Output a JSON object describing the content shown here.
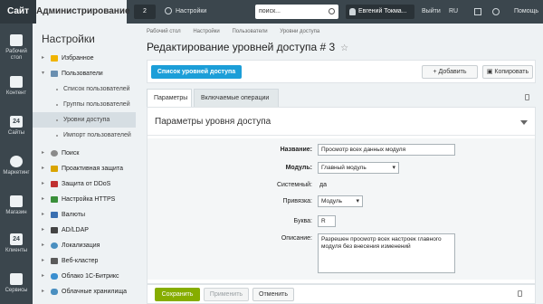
{
  "topbar": {
    "site_label": "Сайт",
    "admin_label": "Администрирование",
    "notifications_count": "2",
    "settings_label": "Настройки",
    "search_value": "поиск...",
    "user_name": "Евгений Токма...",
    "exit_label": "Выйти",
    "lang_label": "RU",
    "help_label": "Помощь"
  },
  "iconbar": [
    {
      "label": "Рабочий стол",
      "icon": "desktop-icon"
    },
    {
      "label": "Контент",
      "icon": "content-icon"
    },
    {
      "label": "Сайты",
      "icon": "sites-icon"
    },
    {
      "label": "Маркетинг",
      "icon": "marketing-icon"
    },
    {
      "label": "Магазин",
      "icon": "shop-icon"
    },
    {
      "label": "Клиенты",
      "icon": "clients-icon"
    },
    {
      "label": "Сервисы",
      "icon": "services-icon"
    }
  ],
  "iconbar_glyphs": {
    "sites": "24",
    "clients": "24"
  },
  "menu": {
    "title": "Настройки",
    "items": [
      {
        "label": "Избранное",
        "color": "#f0b400"
      },
      {
        "label": "Пользователи",
        "color": "#6a8fb0"
      },
      {
        "label": "Список пользователей"
      },
      {
        "label": "Группы пользователей"
      },
      {
        "label": "Уровни доступа"
      },
      {
        "label": "Импорт пользователей"
      },
      {
        "label": "Поиск",
        "color": "#8a8a8a"
      },
      {
        "label": "Проактивная защита",
        "color": "#d9a400"
      },
      {
        "label": "Защита от DDoS",
        "color": "#c03030"
      },
      {
        "label": "Настройка HTTPS",
        "color": "#3a8f3a"
      },
      {
        "label": "Валюты",
        "color": "#3a6fb0"
      },
      {
        "label": "AD/LDAP",
        "color": "#444444"
      },
      {
        "label": "Локализация",
        "color": "#4a8fc0"
      },
      {
        "label": "Веб-кластер",
        "color": "#5a5a5a"
      },
      {
        "label": "Облако 1С-Битрикс",
        "color": "#3a8fd0"
      },
      {
        "label": "Облачные хранилища",
        "color": "#4a8fc0"
      }
    ]
  },
  "breadcrumbs": [
    "Рабочий стол",
    "Настройки",
    "Пользователи",
    "Уровни доступа"
  ],
  "page_title": "Редактирование уровней доступа # 3",
  "toolbar": {
    "list_button": "Список уровней доступа",
    "add_button": "Добавить",
    "copy_button": "Копировать"
  },
  "tabs": [
    "Параметры",
    "Включаемые операции"
  ],
  "panel": {
    "title": "Параметры уровня доступа",
    "fields": {
      "name_label": "Название:",
      "name_value": "Просмотр всех данных модуля",
      "module_label": "Модуль:",
      "module_value": "Главный модуль",
      "system_label": "Системный:",
      "system_value": "да",
      "binding_label": "Привязка:",
      "binding_value": "Модуль",
      "letter_label": "Буква:",
      "letter_value": "R",
      "description_label": "Описание:",
      "description_value": "Разрешен просмотр всех настроек главного модуля без внесения изменений"
    }
  },
  "footer": {
    "save": "Сохранить",
    "apply": "Применить",
    "cancel": "Отменить"
  },
  "colors": {
    "topbar": "#3b464d",
    "accent_blue": "#1c9ed8",
    "save_green": "#86ad00"
  }
}
